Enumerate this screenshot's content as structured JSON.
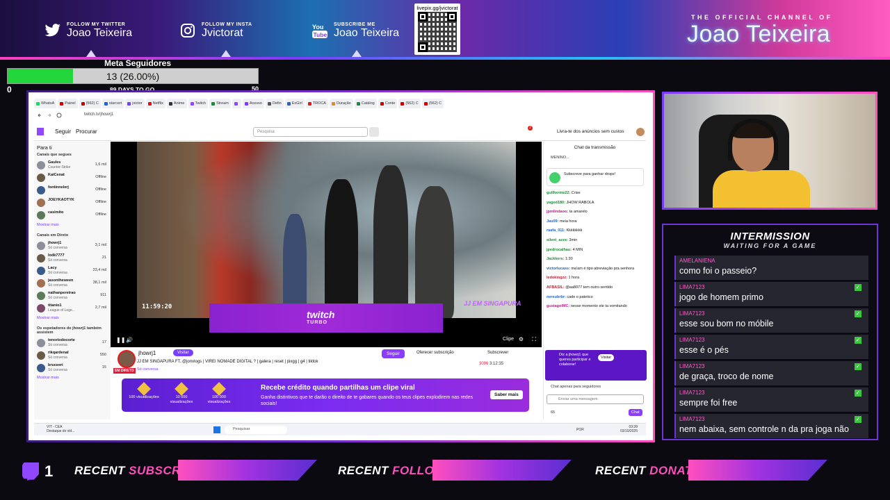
{
  "banner": {
    "twitter": {
      "label": "FOLLOW MY TWITTER",
      "name": "Joao Teixeira"
    },
    "insta": {
      "label": "FOLLOW MY INSTA",
      "name": "Jvictorat"
    },
    "youtube": {
      "label": "SUBSCRIBE ME",
      "name": "Joao Teixeira"
    },
    "qr_label": "livepix.gg/jvictorat",
    "official": "THE OFFICIAL CHANNEL OF",
    "channel": "Joao Teixeira"
  },
  "goal": {
    "title": "Meta Seguidores",
    "text": "13 (26.00%)",
    "progress": 0.26,
    "min": "0",
    "days": "89 DAYS TO GO",
    "max": "50"
  },
  "browser": {
    "tabs": [
      "WhatsA",
      "Painel",
      "(562) C",
      "starcert",
      "jvictor",
      "Netflix",
      "Anime",
      "Twitch",
      "Stream",
      "",
      "Acesso",
      "Defin",
      "ExGirl",
      "TROCA",
      "Duração",
      "Catálog",
      "Conte",
      "(562) C",
      "(562) C"
    ],
    "url": "twitch.tv/jhowrj1"
  },
  "twitch": {
    "follow_nav": "Seguir",
    "browse_nav": "Procurar",
    "search_placeholder": "Pesquisa",
    "ad_free": "Livra-te dos anúncios sem custos",
    "notif_count": "2"
  },
  "sidebar": {
    "title": "Para ti",
    "followed_title": "Canais que segues",
    "followed": [
      {
        "name": "Gaules",
        "game": "Counter-Strike",
        "viewers": "1,6 mil"
      },
      {
        "name": "KaiCenat",
        "game": "",
        "viewers": "Offline"
      },
      {
        "name": "fontinnelerj",
        "game": "",
        "viewers": "Offline"
      },
      {
        "name": "JOEYKAOTYK",
        "game": "",
        "viewers": "Offline"
      },
      {
        "name": "casimito",
        "game": "",
        "viewers": "Offline"
      }
    ],
    "more1": "Mostrar mais",
    "live_title": "Canais em Direto",
    "live": [
      {
        "name": "jhowrj1",
        "game": "Só conversa",
        "viewers": "3,1 mil"
      },
      {
        "name": "lodk7777",
        "game": "Só conversa",
        "viewers": "21"
      },
      {
        "name": "Lacy",
        "game": "Só conversa",
        "viewers": "23,4 mil"
      },
      {
        "name": "jasontheween",
        "game": "Só conversa",
        "viewers": "38,1 mil"
      },
      {
        "name": "nathanpereirao",
        "game": "Só conversa",
        "viewers": "911"
      },
      {
        "name": "titanio1",
        "game": "League of Lege...",
        "viewers": "2,7 mil"
      }
    ],
    "more2": "Mostrar mais",
    "also_title": "Os espetadores do jhowrj1 também assistem",
    "also": [
      {
        "name": "tenoriodocorte",
        "game": "Só conversa",
        "viewers": "17"
      },
      {
        "name": "rikqardenal",
        "game": "Só conversa",
        "viewers": "550"
      },
      {
        "name": "bruceeri",
        "game": "Só conversa",
        "viewers": "15"
      }
    ],
    "more3": "Mostrar mais"
  },
  "player": {
    "timestamp": "11:59:20",
    "turbo_brand": "twitch",
    "turbo_sub": "TURBO",
    "sig": "JJ EM SINGAPURA",
    "clip": "Clipe"
  },
  "stream": {
    "name": "jhowrj1",
    "visit": "Visitar",
    "title": "JJ EM SINGAPURA FT. @jonvlogs | VIREI NOMADE DIGITAL ? | galera | reset | pixgg | g4 | tiktok",
    "category": "Só conversa",
    "live": "EM DIRETO",
    "follow": "Seguir",
    "offer": "Oferecer subscrição",
    "subscribe": "Subscrever",
    "viewers": "3096",
    "uptime": "3:12:35"
  },
  "promo": {
    "title": "Recebe crédito quando partilhas um clipe viral",
    "text": "Ganha distintivos que te darão o direito de te gabares quando os teus clipes explodirem nas redes sociais!",
    "button": "Saber mais",
    "milestones": [
      "100 visualizações",
      "10 000 visualizações",
      "100 000 visualizações"
    ]
  },
  "chat": {
    "title": "Chat da transmissão",
    "pinned": "MENINO...",
    "drops": "Subscreve para ganhar drops!",
    "lines": [
      {
        "user": "guilhxrme22:",
        "text": "Crise",
        "color": "#1e8a3c"
      },
      {
        "user": "yaged180:",
        "text": "JHOW RABOLA",
        "color": "#1e8a3c"
      },
      {
        "user": "jpmlindaoo:",
        "text": "ta amarelo",
        "color": "#c0148a"
      },
      {
        "user": "Jau09:",
        "text": "meia hora",
        "color": "#1e63d0"
      },
      {
        "user": "raafa_011:",
        "text": "Kkkkkkkk",
        "color": "#1e63d0"
      },
      {
        "user": "silent_azzx:",
        "text": "3min",
        "color": "#1e8a3c"
      },
      {
        "user": "jpedrocalhau:",
        "text": "4 MIN",
        "color": "#1e8a3c"
      },
      {
        "user": "Jackkers:",
        "text": "1:30",
        "color": "#1e8a3c"
      },
      {
        "user": "victorlucass:",
        "text": "ma'am é tipo abreviação pra senhora",
        "color": "#1e63d0"
      },
      {
        "user": "ledokingzz:",
        "text": "1 hora",
        "color": "#c01e2e"
      },
      {
        "user": "AFBASIL:",
        "text": "@aa8077 tem outro sentido",
        "color": "#c01e2e"
      },
      {
        "user": "nereubrbr:",
        "text": "cade o patetico",
        "color": "#1e63d0"
      },
      {
        "user": "gustagolMC:",
        "text": "nesse momento ele ta vomitando",
        "color": "#c0148a"
      }
    ],
    "cta": "Diz a jhowrj1 que queres participar e colaborar!",
    "cta_btn": "Visitar",
    "followers_only": "Chat apenas para seguidores",
    "input_placeholder": "Enviar uma mensagem",
    "points": "65",
    "send": "Chat"
  },
  "taskbar": {
    "weather": "VIT - CEA",
    "weather_sub": "Destaque do vid...",
    "search": "Pesquisar",
    "lang": "POR",
    "time": "03:39",
    "date": "03/10/2025"
  },
  "intermission": {
    "title": "INTERMISSION",
    "subtitle": "WAITING FOR A GAME",
    "messages": [
      {
        "user": "AMELANIENA",
        "text": "como foi o passeio?",
        "check": false
      },
      {
        "user": "LIMA7123",
        "text": "jogo de homem primo",
        "check": true
      },
      {
        "user": "LIMA7123",
        "text": "esse sou bom no móbile",
        "check": true
      },
      {
        "user": "LIMA7123",
        "text": "esse é o pés",
        "check": true
      },
      {
        "user": "LIMA7123",
        "text": "de graça, troco de nome",
        "check": true
      },
      {
        "user": "LIMA7123",
        "text": "sempre foi free",
        "check": true
      },
      {
        "user": "LIMA7123",
        "text": "nem abaixa, sem controle n da pra joga não",
        "check": true
      }
    ]
  },
  "bottom": {
    "count": "1",
    "subscriber": {
      "pre": "RECENT ",
      "hl": "SUBSCRIBER"
    },
    "follower": {
      "pre": "RECENT ",
      "hl": "FOLLOWER"
    },
    "donation": {
      "pre": "RECENT ",
      "hl": "DONATION"
    }
  },
  "colors": {
    "accent": "#ff4fbf",
    "twitch": "#9146ff",
    "goal": "#22d63c"
  }
}
